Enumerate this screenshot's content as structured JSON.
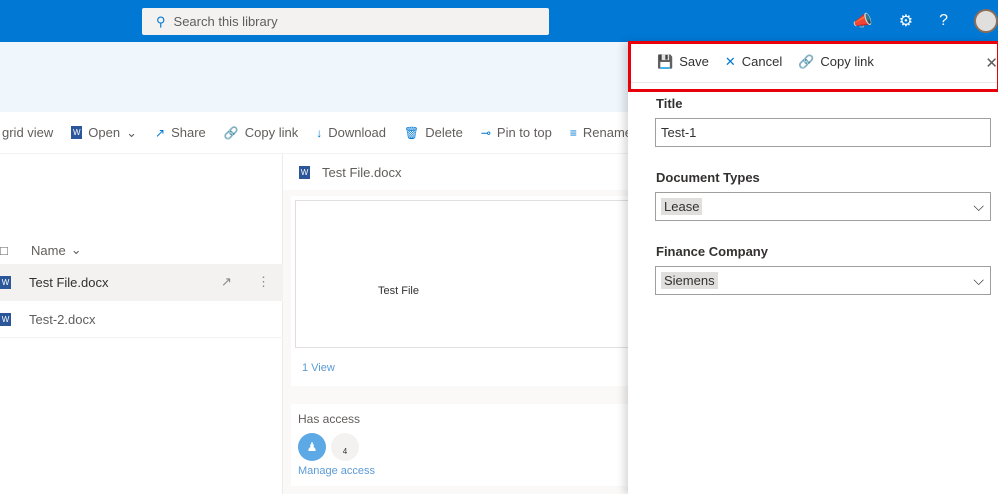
{
  "topbar": {
    "search_placeholder": "Search this library",
    "icons": [
      "megaphone-icon",
      "gear-icon",
      "help-icon"
    ],
    "help_label": "?",
    "accent": "#0078d4"
  },
  "commands": [
    {
      "label": "grid view"
    },
    {
      "label": "Open",
      "icon": "word-icon"
    },
    {
      "label": "Share",
      "icon": "share-icon"
    },
    {
      "label": "Copy link",
      "icon": "link-icon"
    },
    {
      "label": "Download",
      "icon": "download-icon"
    },
    {
      "label": "Delete",
      "icon": "trash-icon"
    },
    {
      "label": "Pin to top",
      "icon": "pin-icon"
    },
    {
      "label": "Rename",
      "icon": "rename-icon"
    }
  ],
  "list": {
    "name_header": "Name",
    "files": [
      {
        "name": "Test File.docx"
      },
      {
        "name": "Test-2.docx"
      }
    ]
  },
  "preview": {
    "file_name": "Test File.docx",
    "doc_text": "Test File",
    "views": "1 View",
    "has_access": "Has access",
    "share_count": "4",
    "manage_access": "Manage access"
  },
  "panel": {
    "save": "Save",
    "cancel": "Cancel",
    "copy_link": "Copy link",
    "fields": [
      {
        "label": "Title",
        "value": "Test-1"
      },
      {
        "label": "Document Types",
        "value": "Lease"
      },
      {
        "label": "Finance Company",
        "value": "Siemens"
      }
    ]
  }
}
